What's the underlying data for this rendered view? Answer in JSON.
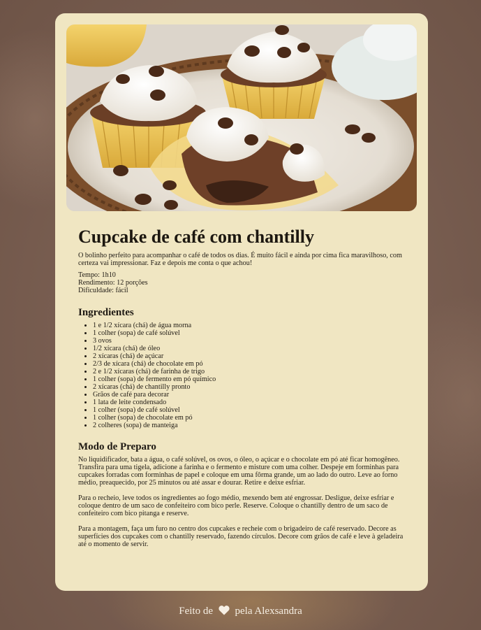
{
  "recipe": {
    "title": "Cupcake de café com chantilly",
    "intro": "O bolinho perfeito para acompanhar o café de todos os dias. É muito fácil e ainda por cima fica maravilhoso, com certeza vai impressionar. Faz e depois me conta o que achou!",
    "meta": {
      "time": "Tempo: 1h10",
      "yield": "Rendimento: 12 porções",
      "difficulty": "Dificuldade: fácil"
    },
    "ingredients_title": "Ingredientes",
    "ingredients": [
      "1 e 1/2 xícara (chá) de água morna",
      "1 colher (sopa) de café solúvel",
      "3 ovos",
      "1/2 xícara (chá) de óleo",
      "2 xícaras (chá) de açúcar",
      "2/3 de xícara (chá) de chocolate em pó",
      "2 e 1/2 xícaras (chá) de farinha de trigo",
      "1 colher (sopa) de fermento em pó químico",
      "2 xícaras (chá) de chantilly pronto",
      "Grãos de café para decorar",
      "1 lata de leite condensado",
      "1 colher (sopa) de café solúvel",
      "1 colher (sopa) de chocolate em pó",
      "2 colheres (sopa) de manteiga"
    ],
    "prep_title": "Modo de Preparo",
    "prep": [
      "No liquidificador, bata a água, o café solúvel, os ovos, o óleo, o açúcar e o chocolate em pó até ficar homogêneo. Transfira para uma tigela, adicione a farinha e o fermento e misture com uma colher. Despeje em forminhas para cupcakes forradas com forminhas de papel e coloque em uma fôrma grande, um ao lado do outro. Leve ao forno médio, preaquecido, por 25 minutos ou até assar e dourar. Retire e deixe esfriar.",
      "Para o recheio, leve todos os ingredientes ao fogo médio, mexendo bem até engrossar. Desligue, deixe esfriar e coloque dentro de um saco de confeiteiro com bico perle. Reserve. Coloque o chantilly dentro de um saco de confeiteiro com bico pitanga e reserve.",
      "Para a montagem, faça um furo no centro dos cupcakes e recheie com o brigadeiro de café reservado. Decore as superfícies dos cupcakes com o chantilly reservado, fazendo círculos. Decore com grãos de café e leve à geladeira até o momento de servir."
    ]
  },
  "footer": {
    "prefix": "Feito de",
    "heart_icon": "heart-icon",
    "suffix": "pela Alexsandra"
  },
  "colors": {
    "card": "#f0e6c2",
    "background": "#7a5f52",
    "footer_text": "#f6efe4"
  }
}
